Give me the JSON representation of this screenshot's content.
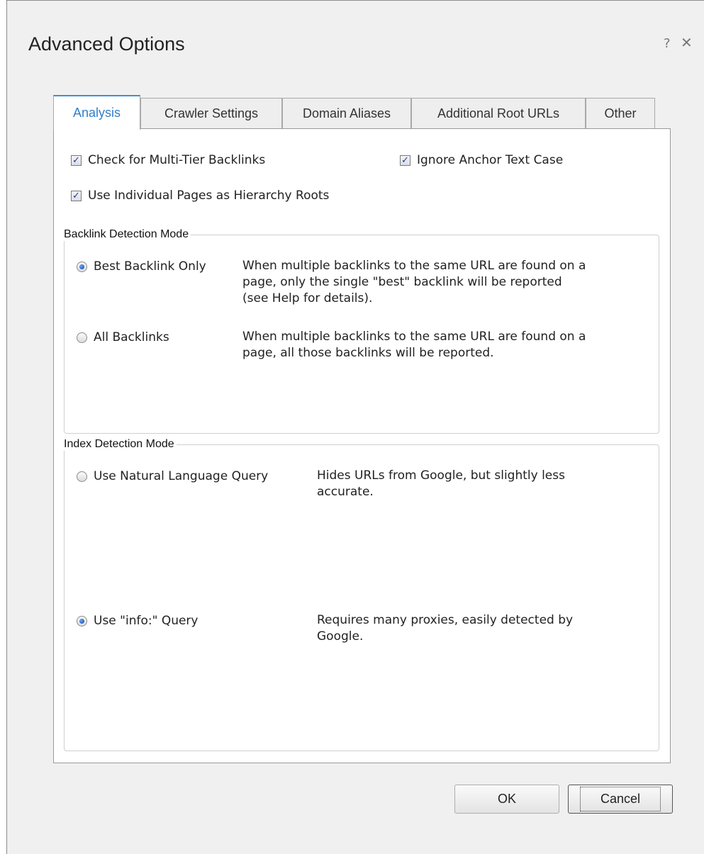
{
  "dialog": {
    "title": "Advanced Options",
    "help_glyph": "?",
    "close_glyph": "✕"
  },
  "tabs": [
    {
      "label": "Analysis",
      "active": true
    },
    {
      "label": "Crawler Settings",
      "active": false
    },
    {
      "label": "Domain Aliases",
      "active": false
    },
    {
      "label": "Additional Root URLs",
      "active": false
    },
    {
      "label": "Other",
      "active": false
    }
  ],
  "options": {
    "multi_tier": {
      "label": "Check for Multi-Tier Backlinks",
      "checked": true
    },
    "ignore_case": {
      "label": "Ignore Anchor Text Case",
      "checked": true
    },
    "individual_pages": {
      "label": "Use Individual Pages as Hierarchy Roots",
      "checked": true
    }
  },
  "backlink_mode": {
    "legend": "Backlink Detection Mode",
    "best": {
      "label": "Best Backlink Only",
      "selected": true,
      "desc": "When multiple backlinks to the same URL are found on a\npage, only the single \"best\" backlink will be reported\n(see Help for details)."
    },
    "all": {
      "label": "All Backlinks",
      "selected": false,
      "desc": "When multiple backlinks to the same URL are found on a\npage, all those backlinks will be reported."
    }
  },
  "index_mode": {
    "legend": "Index Detection Mode",
    "natural": {
      "label": "Use Natural Language Query",
      "selected": false,
      "desc": "Hides URLs from Google, but slightly less\naccurate."
    },
    "info": {
      "label": "Use \"info:\" Query",
      "selected": true,
      "desc": "Requires many proxies, easily detected by\nGoogle."
    }
  },
  "buttons": {
    "ok": "OK",
    "cancel": "Cancel"
  },
  "colors": {
    "active_tab_accent": "#3c8fd9",
    "check_mark": "#1f3f8f"
  },
  "icons": {
    "checkmark": "✓"
  }
}
